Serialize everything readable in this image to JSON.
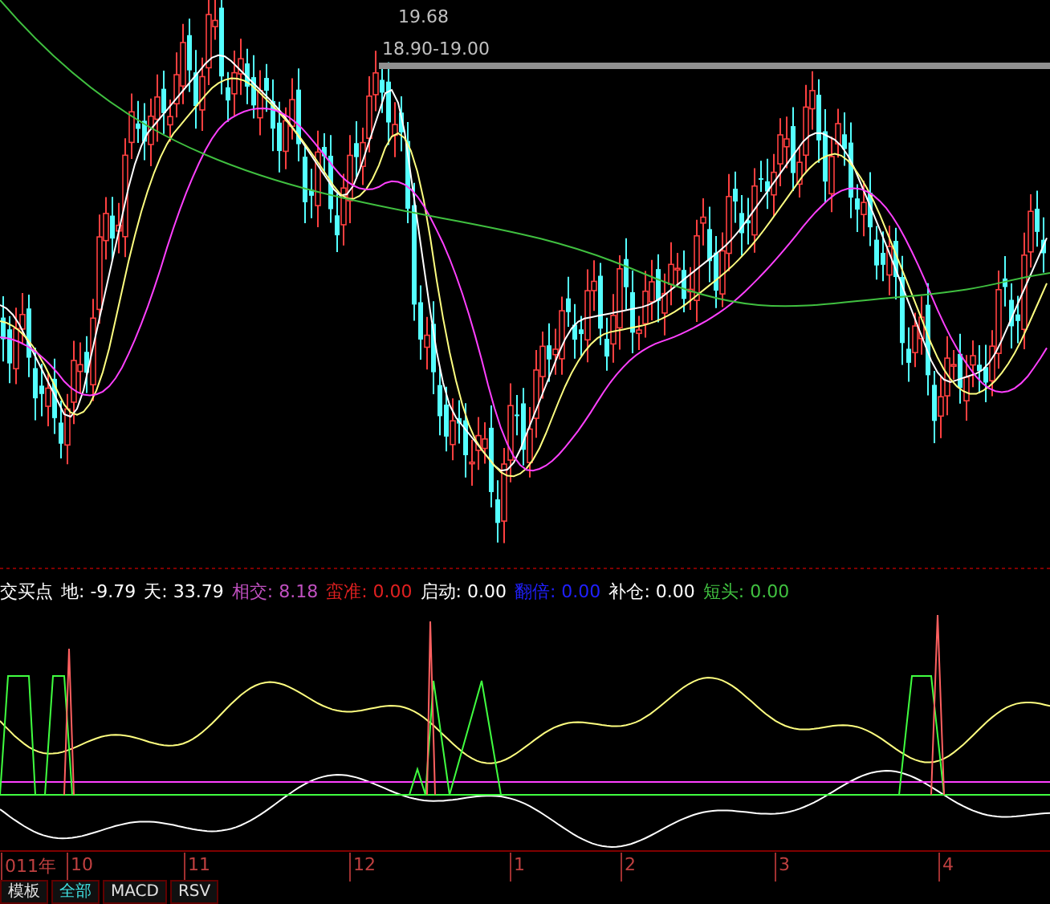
{
  "price_chart": {
    "annotations": [
      {
        "kind": "high",
        "text": "19.68"
      },
      {
        "kind": "range",
        "text": "18.90-19.00"
      }
    ]
  },
  "indicator": {
    "name": "交买点",
    "items": [
      {
        "label": "地:",
        "value": "-9.79",
        "color": "#ffffff"
      },
      {
        "label": "天:",
        "value": "33.79",
        "color": "#ffffff"
      },
      {
        "label": "相交:",
        "value": "8.18",
        "color": "#c050c0"
      },
      {
        "label": "蛮准:",
        "value": "0.00",
        "color": "#e02020"
      },
      {
        "label": "启动:",
        "value": "0.00",
        "color": "#ffffff"
      },
      {
        "label": "翻倍:",
        "value": "0.00",
        "color": "#2020ff"
      },
      {
        "label": "补仓:",
        "value": "0.00",
        "color": "#ffffff"
      },
      {
        "label": "短头:",
        "value": "0.00",
        "color": "#40c040"
      }
    ]
  },
  "x_axis": {
    "labels": [
      "011年",
      "10",
      "11",
      "12",
      "1",
      "2",
      "3",
      "4"
    ]
  },
  "tabs": [
    {
      "label": "模板",
      "selected": false
    },
    {
      "label": "全部",
      "selected": true
    },
    {
      "label": "MACD",
      "selected": false
    },
    {
      "label": "RSV",
      "selected": false
    }
  ]
}
